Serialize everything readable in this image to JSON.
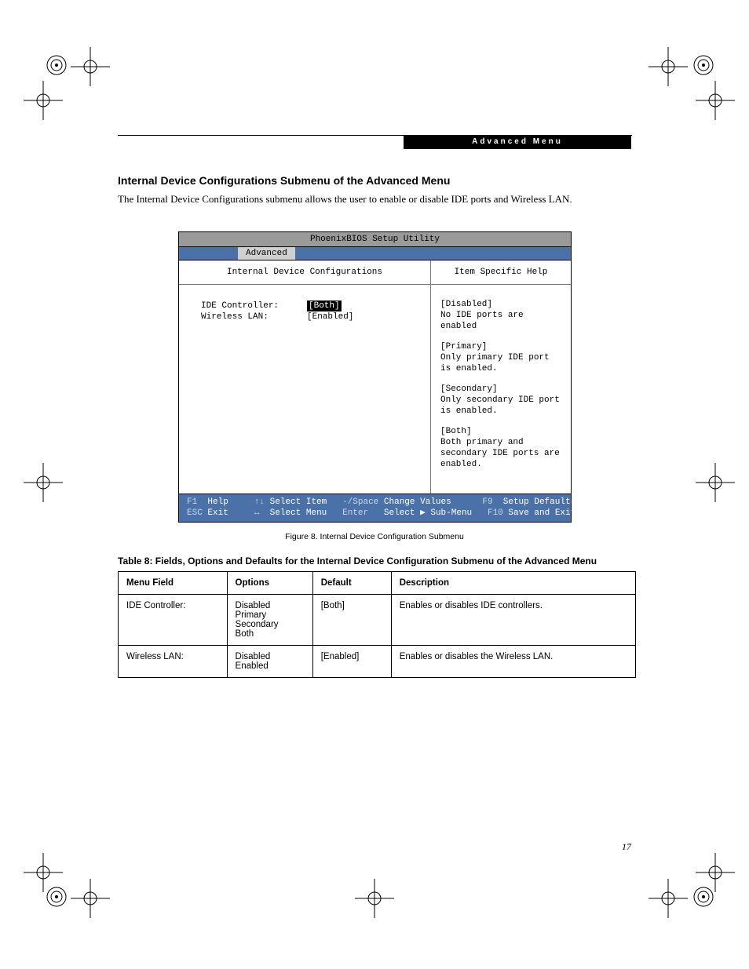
{
  "header_bar": "Advanced Menu",
  "heading": "Internal Device Configurations Submenu of the Advanced Menu",
  "intro": "The Internal Device Configurations submenu allows the user to enable or disable IDE ports and Wireless LAN.",
  "bios": {
    "title": "PhoenixBIOS Setup Utility",
    "tab": "Advanced",
    "left_head": "Internal Device Configurations",
    "right_head": "Item Specific Help",
    "fields": {
      "ide_label": "IDE Controller:",
      "ide_value": "[Both]",
      "wlan_label": "Wireless LAN:",
      "wlan_value": "[Enabled]"
    },
    "help": {
      "p1a": "[Disabled]",
      "p1b": "No IDE ports are enabled",
      "p2a": "[Primary]",
      "p2b": "Only primary IDE port is enabled.",
      "p3a": "[Secondary]",
      "p3b": "Only secondary IDE port is enabled.",
      "p4a": "[Both]",
      "p4b": "Both primary and secondary IDE ports are enabled."
    },
    "footer": {
      "r1k1": "F1",
      "r1t1": "Help",
      "r1k2": "↑↓",
      "r1t2": "Select Item",
      "r1k3": "-/Space",
      "r1t3": "Change Values",
      "r1k4": "F9",
      "r1t4": "Setup Defaults",
      "r2k1": "ESC",
      "r2t1": "Exit",
      "r2k2": "↔",
      "r2t2": "Select Menu",
      "r2k3": "Enter",
      "r2t3": "Select ▶ Sub-Menu",
      "r2k4": "F10",
      "r2t4": "Save and Exit"
    }
  },
  "figure_caption": "Figure 8.  Internal Device Configuration Submenu",
  "table_caption": "Table 8: Fields, Options and Defaults for the Internal Device Configuration Submenu of the Advanced Menu",
  "table": {
    "h1": "Menu Field",
    "h2": "Options",
    "h3": "Default",
    "h4": "Description",
    "r1c1": "IDE Controller:",
    "r1c2": "Disabled\nPrimary\nSecondary\nBoth",
    "r1c3": "[Both]",
    "r1c4": "Enables or disables IDE controllers.",
    "r2c1": "Wireless LAN:",
    "r2c2": "Disabled\nEnabled",
    "r2c3": "[Enabled]",
    "r2c4": "Enables or disables the Wireless LAN."
  },
  "page_number": "17"
}
